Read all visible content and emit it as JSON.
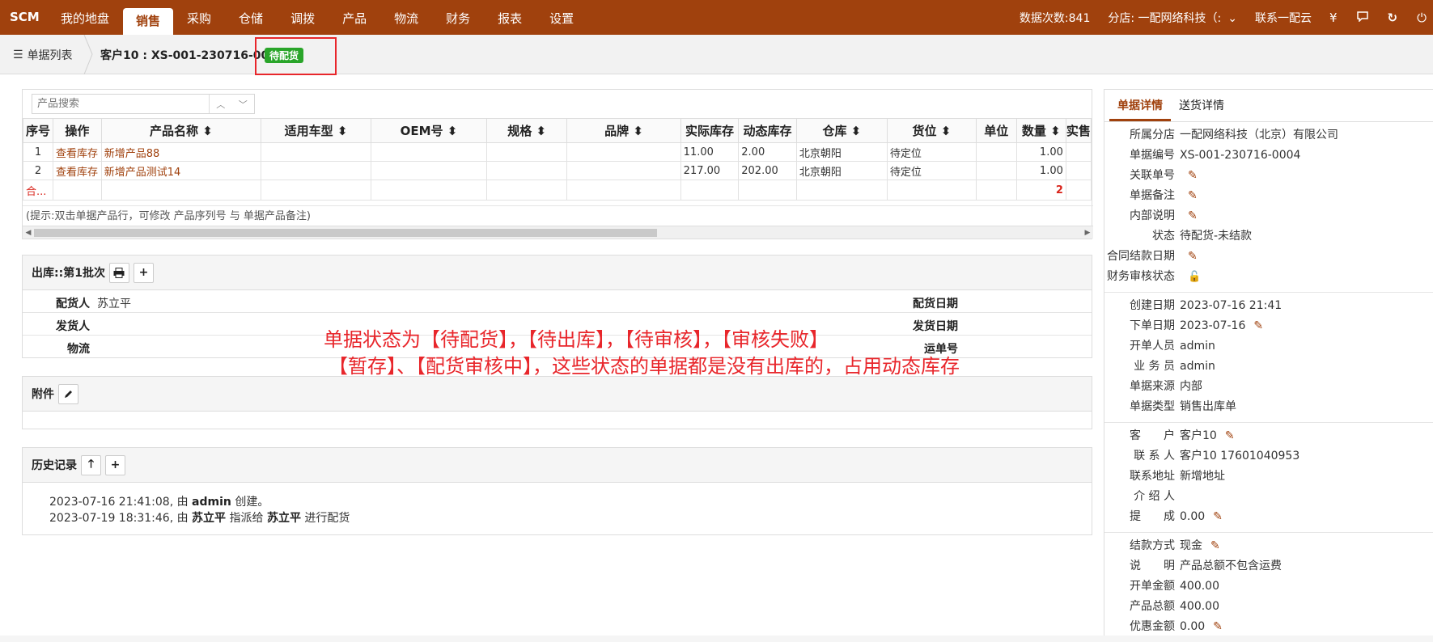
{
  "nav": {
    "brand": "SCM",
    "tabs": [
      "我的地盘",
      "销售",
      "采购",
      "仓储",
      "调拨",
      "产品",
      "物流",
      "财务",
      "报表",
      "设置"
    ],
    "active_tab": "销售",
    "data_count": "数据次数:841",
    "branch": "分店: 一配网络科技（:",
    "contact": "联系一配云",
    "yen_icon": "¥",
    "colors": {
      "nav_bg": "#a0410d",
      "badge_green": "#2aa52a",
      "annotation_red": "#e8262b"
    }
  },
  "breadcrumb": {
    "list_label": "单据列表",
    "title": "客户10 : XS-001-230716-0004",
    "status": "待配货"
  },
  "products": {
    "search_placeholder": "产品搜索",
    "headers": [
      "序号",
      "操作",
      "产品名称 ⬍",
      "适用车型 ⬍",
      "OEM号 ⬍",
      "规格 ⬍",
      "品牌 ⬍",
      "实际库存",
      "动态库存",
      "仓库 ⬍",
      "货位 ⬍",
      "单位",
      "数量 ⬍",
      "实售"
    ],
    "rows": [
      [
        "1",
        "查看库存",
        "新增产品88",
        "",
        "",
        "",
        "",
        "11.00",
        "2.00",
        "北京朝阳",
        "待定位",
        "",
        "1.00",
        ""
      ],
      [
        "2",
        "查看库存",
        "新增产品测试14",
        "",
        "",
        "",
        "",
        "217.00",
        "202.00",
        "北京朝阳",
        "待定位",
        "",
        "1.00",
        ""
      ]
    ],
    "sum_label": "合...",
    "sum_qty": "2",
    "tip": "(提示:双击单据产品行，可修改 产品序列号 与 单据产品备注)"
  },
  "ship": {
    "title": "出库::第1批次",
    "picker_label": "配货人",
    "picker_value": "苏立平",
    "pick_date_label": "配货日期",
    "shipper_label": "发货人",
    "ship_date_label": "发货日期",
    "logistics_label": "物流",
    "tracking_label": "运单号"
  },
  "attach": {
    "title": "附件"
  },
  "history": {
    "title": "历史记录",
    "lines": [
      {
        "time": "2023-07-16 21:41:08, 由 ",
        "who": "admin",
        "rest": " 创建。"
      },
      {
        "time": "2023-07-19 18:31:46, 由 ",
        "who": "苏立平",
        "mid": " 指派给 ",
        "who2": "苏立平",
        "rest": " 进行配货"
      }
    ]
  },
  "annotation": {
    "line1": "单据状态为【待配货】，【待出库】，【待审核】，【审核失败】",
    "line2": "【暂存】、【配货审核中】，这些状态的单据都是没有出库的，占用动态库存"
  },
  "right": {
    "tabs": [
      "单据详情",
      "送货详情"
    ],
    "group1": [
      {
        "k": "所属分店",
        "v": "一配网络科技（北京）有限公司"
      },
      {
        "k": "单据编号",
        "v": "XS-001-230716-0004"
      },
      {
        "k": "关联单号",
        "v": "",
        "edit": true
      },
      {
        "k": "单据备注",
        "v": "",
        "edit": true
      },
      {
        "k": "内部说明",
        "v": "",
        "edit": true
      },
      {
        "k": "状态",
        "v": "待配货-未结款"
      },
      {
        "k": "合同结款日期",
        "v": "",
        "edit": true
      },
      {
        "k": "财务审核状态",
        "v": "",
        "lock": true
      }
    ],
    "group2": [
      {
        "k": "创建日期",
        "v": "2023-07-16 21:41"
      },
      {
        "k": "下单日期",
        "v": "2023-07-16",
        "edit": true
      },
      {
        "k": "开单人员",
        "v": "admin"
      },
      {
        "k": "业 务 员",
        "v": "admin"
      },
      {
        "k": "单据来源",
        "v": "内部"
      },
      {
        "k": "单据类型",
        "v": "销售出库单"
      }
    ],
    "group3": [
      {
        "k": "客　　户",
        "v": "客户10",
        "edit": true
      },
      {
        "k": "联 系 人",
        "v": "客户10 17601040953"
      },
      {
        "k": "联系地址",
        "v": "新增地址"
      },
      {
        "k": "介 绍 人",
        "v": ""
      },
      {
        "k": "提　　成",
        "v": "0.00",
        "edit": true
      }
    ],
    "group4": [
      {
        "k": "结款方式",
        "v": "现金",
        "edit": true
      },
      {
        "k": "说　　明",
        "v": "产品总额不包含运费"
      },
      {
        "k": "开单金额",
        "v": "400.00"
      },
      {
        "k": "产品总额",
        "v": "400.00"
      },
      {
        "k": "优惠金额",
        "v": "0.00",
        "edit": true
      }
    ]
  }
}
